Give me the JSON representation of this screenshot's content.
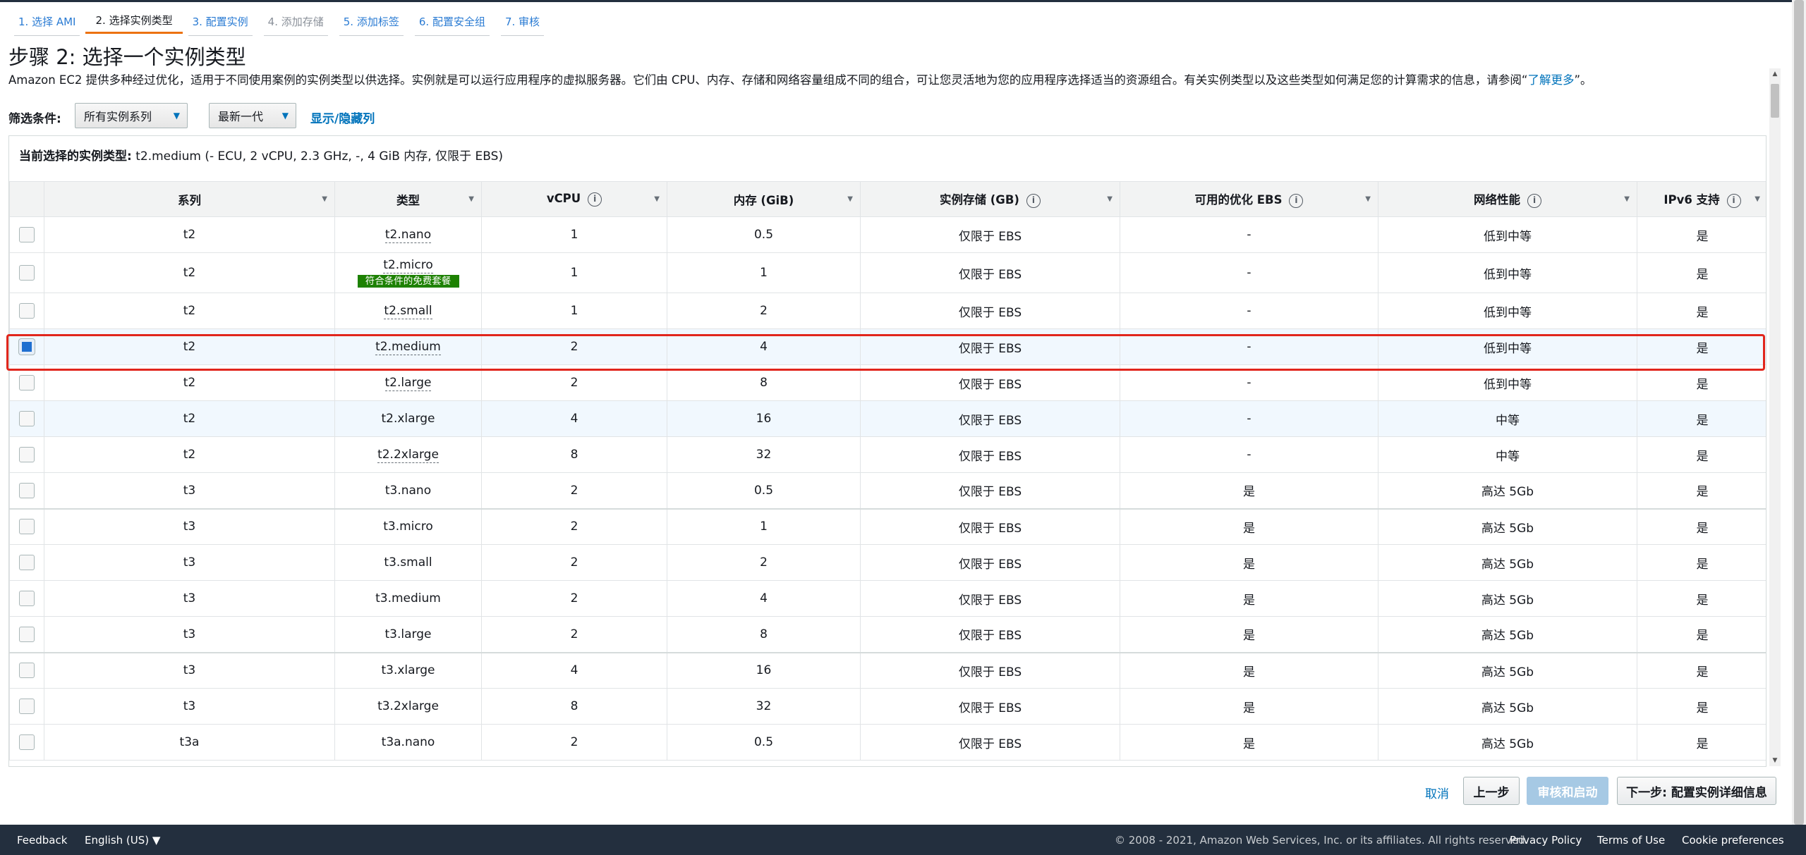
{
  "wizard": {
    "tabs": [
      {
        "label": "1. 选择 AMI",
        "state": "done"
      },
      {
        "label": "2. 选择实例类型",
        "state": "active"
      },
      {
        "label": "3. 配置实例",
        "state": "done"
      },
      {
        "label": "4. 添加存储",
        "state": "todo"
      },
      {
        "label": "5. 添加标签",
        "state": "done"
      },
      {
        "label": "6. 配置安全组",
        "state": "done"
      },
      {
        "label": "7. 审核",
        "state": "done"
      }
    ]
  },
  "page": {
    "title": "步骤 2: 选择一个实例类型",
    "description": "Amazon EC2 提供多种经过优化，适用于不同使用案例的实例类型以供选择。实例就是可以运行应用程序的虚拟服务器。它们由 CPU、内存、存储和网络容量组成不同的组合，可让您灵活地为您的应用程序选择适当的资源组合。有关实例类型以及这些类型如何满足您的计算需求的信息，请参阅“",
    "learn_more": "了解更多",
    "description_end": "”。"
  },
  "filter": {
    "label": "筛选条件:",
    "family_value": "所有实例系列",
    "generation_value": "最新一代",
    "toggle_columns": "显示/隐藏列"
  },
  "current_selection": {
    "label": "当前选择的实例类型:",
    "value": "t2.medium (- ECU, 2 vCPU, 2.3 GHz, -, 4 GiB 内存, 仅限于 EBS)"
  },
  "table": {
    "headers": {
      "family": "系列",
      "type": "类型",
      "vcpu": "vCPU",
      "memory": "内存 (GiB)",
      "storage": "实例存储 (GB)",
      "ebs": "可用的优化 EBS",
      "network": "网络性能",
      "ipv6": "IPv6 支持"
    },
    "free_tier_badge": "符合条件的免费套餐",
    "rows": [
      {
        "family": "t2",
        "type": "t2.nano",
        "vcpu": "1",
        "memory": "0.5",
        "storage": "仅限于 EBS",
        "ebs": "-",
        "network": "低到中等",
        "ipv6": "是"
      },
      {
        "family": "t2",
        "type": "t2.micro",
        "vcpu": "1",
        "memory": "1",
        "storage": "仅限于 EBS",
        "ebs": "-",
        "network": "低到中等",
        "ipv6": "是"
      },
      {
        "family": "t2",
        "type": "t2.small",
        "vcpu": "1",
        "memory": "2",
        "storage": "仅限于 EBS",
        "ebs": "-",
        "network": "低到中等",
        "ipv6": "是"
      },
      {
        "family": "t2",
        "type": "t2.medium",
        "vcpu": "2",
        "memory": "4",
        "storage": "仅限于 EBS",
        "ebs": "-",
        "network": "低到中等",
        "ipv6": "是"
      },
      {
        "family": "t2",
        "type": "t2.large",
        "vcpu": "2",
        "memory": "8",
        "storage": "仅限于 EBS",
        "ebs": "-",
        "network": "低到中等",
        "ipv6": "是"
      },
      {
        "family": "t2",
        "type": "t2.xlarge",
        "vcpu": "4",
        "memory": "16",
        "storage": "仅限于 EBS",
        "ebs": "-",
        "network": "中等",
        "ipv6": "是"
      },
      {
        "family": "t2",
        "type": "t2.2xlarge",
        "vcpu": "8",
        "memory": "32",
        "storage": "仅限于 EBS",
        "ebs": "-",
        "network": "中等",
        "ipv6": "是"
      },
      {
        "family": "t3",
        "type": "t3.nano",
        "vcpu": "2",
        "memory": "0.5",
        "storage": "仅限于 EBS",
        "ebs": "是",
        "network": "高达 5Gb",
        "ipv6": "是"
      },
      {
        "family": "t3",
        "type": "t3.micro",
        "vcpu": "2",
        "memory": "1",
        "storage": "仅限于 EBS",
        "ebs": "是",
        "network": "高达 5Gb",
        "ipv6": "是"
      },
      {
        "family": "t3",
        "type": "t3.small",
        "vcpu": "2",
        "memory": "2",
        "storage": "仅限于 EBS",
        "ebs": "是",
        "network": "高达 5Gb",
        "ipv6": "是"
      },
      {
        "family": "t3",
        "type": "t3.medium",
        "vcpu": "2",
        "memory": "4",
        "storage": "仅限于 EBS",
        "ebs": "是",
        "network": "高达 5Gb",
        "ipv6": "是"
      },
      {
        "family": "t3",
        "type": "t3.large",
        "vcpu": "2",
        "memory": "8",
        "storage": "仅限于 EBS",
        "ebs": "是",
        "network": "高达 5Gb",
        "ipv6": "是"
      },
      {
        "family": "t3",
        "type": "t3.xlarge",
        "vcpu": "4",
        "memory": "16",
        "storage": "仅限于 EBS",
        "ebs": "是",
        "network": "高达 5Gb",
        "ipv6": "是"
      },
      {
        "family": "t3",
        "type": "t3.2xlarge",
        "vcpu": "8",
        "memory": "32",
        "storage": "仅限于 EBS",
        "ebs": "是",
        "network": "高达 5Gb",
        "ipv6": "是"
      },
      {
        "family": "t3a",
        "type": "t3a.nano",
        "vcpu": "2",
        "memory": "0.5",
        "storage": "仅限于 EBS",
        "ebs": "是",
        "network": "高达 5Gb",
        "ipv6": "是"
      }
    ]
  },
  "actions": {
    "cancel": "取消",
    "previous": "上一步",
    "review_launch": "审核和启动",
    "next": "下一步: 配置实例详细信息"
  },
  "footer": {
    "feedback": "Feedback",
    "language": "English (US)",
    "copyright": "© 2008 - 2021, Amazon Web Services, Inc. or its affiliates. All rights reserved.",
    "privacy": "Privacy Policy",
    "terms": "Terms of Use",
    "cookies": "Cookie preferences"
  },
  "colors": {
    "accent_tab": "#ec7211",
    "link": "#0073bb",
    "selection_outline": "#e1261c",
    "free_tier": "#1d8102",
    "footer_bg": "#232f3e"
  }
}
